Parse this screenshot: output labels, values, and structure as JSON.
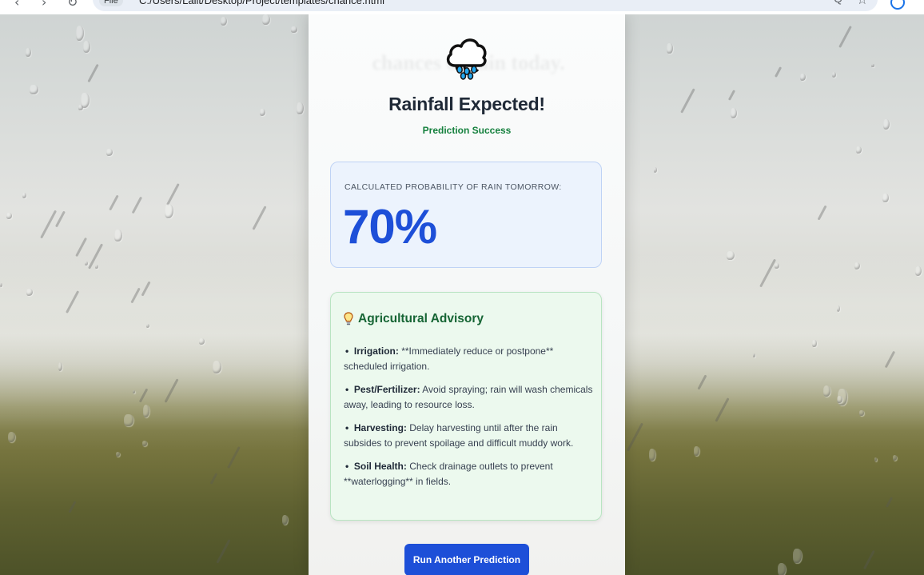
{
  "browser": {
    "back_glyph": "‹",
    "forward_glyph": "›",
    "reload_glyph": "↻",
    "site_info": "File",
    "url": "C:/Users/Lalit/Desktop/Project/templates/chance.html",
    "star_glyph": "☆",
    "zoom_glyph": "Q"
  },
  "background": {
    "ghost_heading": "chances of rain today."
  },
  "result": {
    "icon": "rain-cloud-icon",
    "title": "Rainfall Expected!",
    "subtitle": "Prediction Success",
    "subtitle_color": "#15803d"
  },
  "probability": {
    "label": "CALCULATED PROBABILITY OF RAIN TOMORROW:",
    "value": "70%",
    "value_color": "#1d4fd8"
  },
  "advisory": {
    "icon": "lightbulb-icon",
    "title": "Agricultural Advisory",
    "items": [
      {
        "bullet": "•",
        "label": "Irrigation:",
        "text": " **Immediately reduce or postpone** scheduled irrigation."
      },
      {
        "bullet": "•",
        "label": "Pest/Fertilizer:",
        "text": " Avoid spraying; rain will wash chemicals away, leading to resource loss."
      },
      {
        "bullet": "•",
        "label": "Harvesting:",
        "text": " Delay harvesting until after the rain subsides to prevent spoilage and difficult muddy work."
      },
      {
        "bullet": "•",
        "label": "Soil Health:",
        "text": " Check drainage outlets to prevent **waterlogging** in fields."
      }
    ]
  },
  "actions": {
    "run_again_label": "Run Another Prediction",
    "button_color": "#1d4fd8"
  }
}
